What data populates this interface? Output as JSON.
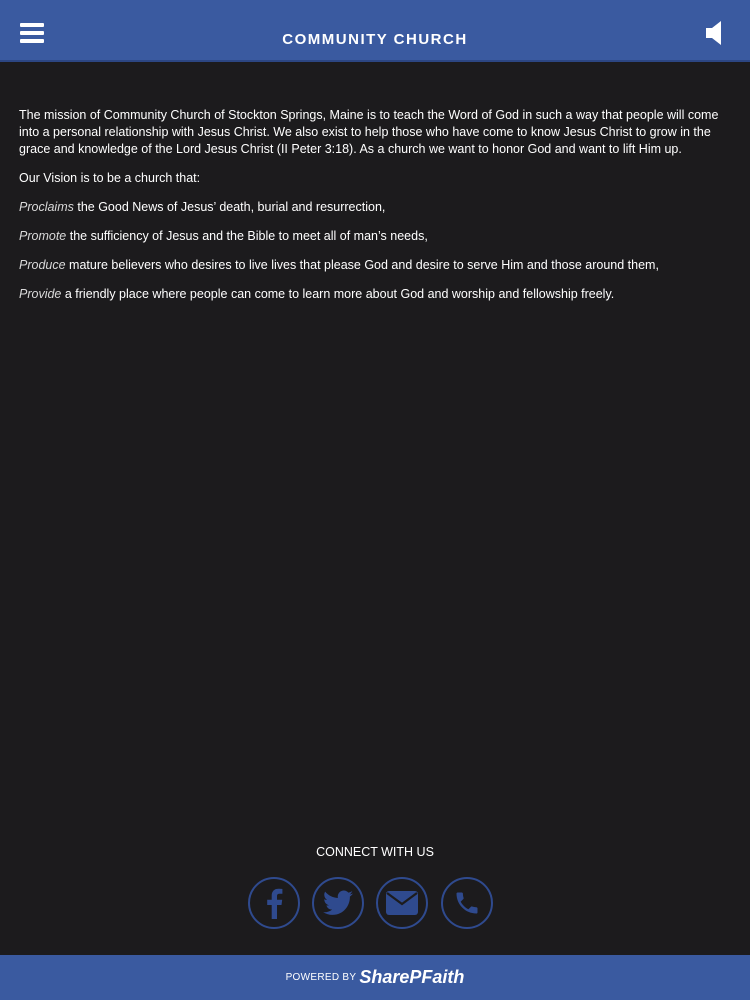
{
  "header": {
    "title": "COMMUNITY CHURCH",
    "menu_icon": "hamburger-menu-icon",
    "sound_icon": "speaker-icon"
  },
  "content": {
    "mission": "The mission of Community Church of Stockton Springs, Maine is to teach the Word of God in such a way that people will come into a personal relationship with Jesus Christ. We also exist to help those who have come to know Jesus Christ to grow in the grace and knowledge of the Lord Jesus Christ (II Peter 3:18). As a church we want to honor God and want to lift Him up.",
    "vision_intro": "Our Vision is to be a church that:",
    "vision_items": [
      {
        "lead": "Proclaims",
        "text": " the Good News of Jesus’ death, burial and resurrection,"
      },
      {
        "lead": "Promote",
        "text": " the sufficiency of Jesus and the Bible to meet all of man’s needs,"
      },
      {
        "lead": "Produce",
        "text": " mature believers who desires to live lives that please God and desire to serve Him and those around them,"
      },
      {
        "lead": "Provide",
        "text": " a friendly place where people can come to learn more about God and worship and fellowship freely."
      }
    ]
  },
  "connect": {
    "label": "CONNECT WITH US",
    "icons": [
      "facebook-icon",
      "twitter-icon",
      "email-icon",
      "phone-icon"
    ]
  },
  "footer": {
    "powered_by": "POWERED BY",
    "brand": "SharePFaith"
  },
  "colors": {
    "header_bg": "#3a5aa0",
    "page_bg": "#1c1b1d",
    "icon_ring": "#2f4a8e",
    "text": "#ffffff"
  }
}
